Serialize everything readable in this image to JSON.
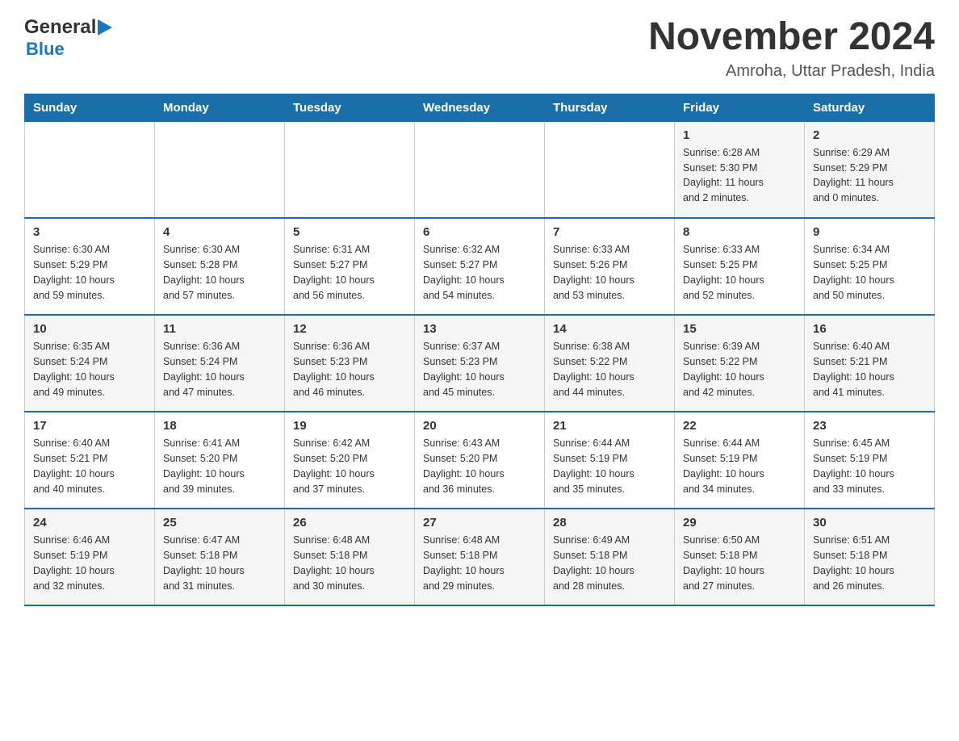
{
  "header": {
    "logo_general": "General",
    "logo_arrow": "▶",
    "logo_blue": "Blue",
    "main_title": "November 2024",
    "subtitle": "Amroha, Uttar Pradesh, India"
  },
  "days_of_week": [
    "Sunday",
    "Monday",
    "Tuesday",
    "Wednesday",
    "Thursday",
    "Friday",
    "Saturday"
  ],
  "weeks": [
    {
      "days": [
        {
          "number": "",
          "info": ""
        },
        {
          "number": "",
          "info": ""
        },
        {
          "number": "",
          "info": ""
        },
        {
          "number": "",
          "info": ""
        },
        {
          "number": "",
          "info": ""
        },
        {
          "number": "1",
          "info": "Sunrise: 6:28 AM\nSunset: 5:30 PM\nDaylight: 11 hours\nand 2 minutes."
        },
        {
          "number": "2",
          "info": "Sunrise: 6:29 AM\nSunset: 5:29 PM\nDaylight: 11 hours\nand 0 minutes."
        }
      ]
    },
    {
      "days": [
        {
          "number": "3",
          "info": "Sunrise: 6:30 AM\nSunset: 5:29 PM\nDaylight: 10 hours\nand 59 minutes."
        },
        {
          "number": "4",
          "info": "Sunrise: 6:30 AM\nSunset: 5:28 PM\nDaylight: 10 hours\nand 57 minutes."
        },
        {
          "number": "5",
          "info": "Sunrise: 6:31 AM\nSunset: 5:27 PM\nDaylight: 10 hours\nand 56 minutes."
        },
        {
          "number": "6",
          "info": "Sunrise: 6:32 AM\nSunset: 5:27 PM\nDaylight: 10 hours\nand 54 minutes."
        },
        {
          "number": "7",
          "info": "Sunrise: 6:33 AM\nSunset: 5:26 PM\nDaylight: 10 hours\nand 53 minutes."
        },
        {
          "number": "8",
          "info": "Sunrise: 6:33 AM\nSunset: 5:25 PM\nDaylight: 10 hours\nand 52 minutes."
        },
        {
          "number": "9",
          "info": "Sunrise: 6:34 AM\nSunset: 5:25 PM\nDaylight: 10 hours\nand 50 minutes."
        }
      ]
    },
    {
      "days": [
        {
          "number": "10",
          "info": "Sunrise: 6:35 AM\nSunset: 5:24 PM\nDaylight: 10 hours\nand 49 minutes."
        },
        {
          "number": "11",
          "info": "Sunrise: 6:36 AM\nSunset: 5:24 PM\nDaylight: 10 hours\nand 47 minutes."
        },
        {
          "number": "12",
          "info": "Sunrise: 6:36 AM\nSunset: 5:23 PM\nDaylight: 10 hours\nand 46 minutes."
        },
        {
          "number": "13",
          "info": "Sunrise: 6:37 AM\nSunset: 5:23 PM\nDaylight: 10 hours\nand 45 minutes."
        },
        {
          "number": "14",
          "info": "Sunrise: 6:38 AM\nSunset: 5:22 PM\nDaylight: 10 hours\nand 44 minutes."
        },
        {
          "number": "15",
          "info": "Sunrise: 6:39 AM\nSunset: 5:22 PM\nDaylight: 10 hours\nand 42 minutes."
        },
        {
          "number": "16",
          "info": "Sunrise: 6:40 AM\nSunset: 5:21 PM\nDaylight: 10 hours\nand 41 minutes."
        }
      ]
    },
    {
      "days": [
        {
          "number": "17",
          "info": "Sunrise: 6:40 AM\nSunset: 5:21 PM\nDaylight: 10 hours\nand 40 minutes."
        },
        {
          "number": "18",
          "info": "Sunrise: 6:41 AM\nSunset: 5:20 PM\nDaylight: 10 hours\nand 39 minutes."
        },
        {
          "number": "19",
          "info": "Sunrise: 6:42 AM\nSunset: 5:20 PM\nDaylight: 10 hours\nand 37 minutes."
        },
        {
          "number": "20",
          "info": "Sunrise: 6:43 AM\nSunset: 5:20 PM\nDaylight: 10 hours\nand 36 minutes."
        },
        {
          "number": "21",
          "info": "Sunrise: 6:44 AM\nSunset: 5:19 PM\nDaylight: 10 hours\nand 35 minutes."
        },
        {
          "number": "22",
          "info": "Sunrise: 6:44 AM\nSunset: 5:19 PM\nDaylight: 10 hours\nand 34 minutes."
        },
        {
          "number": "23",
          "info": "Sunrise: 6:45 AM\nSunset: 5:19 PM\nDaylight: 10 hours\nand 33 minutes."
        }
      ]
    },
    {
      "days": [
        {
          "number": "24",
          "info": "Sunrise: 6:46 AM\nSunset: 5:19 PM\nDaylight: 10 hours\nand 32 minutes."
        },
        {
          "number": "25",
          "info": "Sunrise: 6:47 AM\nSunset: 5:18 PM\nDaylight: 10 hours\nand 31 minutes."
        },
        {
          "number": "26",
          "info": "Sunrise: 6:48 AM\nSunset: 5:18 PM\nDaylight: 10 hours\nand 30 minutes."
        },
        {
          "number": "27",
          "info": "Sunrise: 6:48 AM\nSunset: 5:18 PM\nDaylight: 10 hours\nand 29 minutes."
        },
        {
          "number": "28",
          "info": "Sunrise: 6:49 AM\nSunset: 5:18 PM\nDaylight: 10 hours\nand 28 minutes."
        },
        {
          "number": "29",
          "info": "Sunrise: 6:50 AM\nSunset: 5:18 PM\nDaylight: 10 hours\nand 27 minutes."
        },
        {
          "number": "30",
          "info": "Sunrise: 6:51 AM\nSunset: 5:18 PM\nDaylight: 10 hours\nand 26 minutes."
        }
      ]
    }
  ]
}
